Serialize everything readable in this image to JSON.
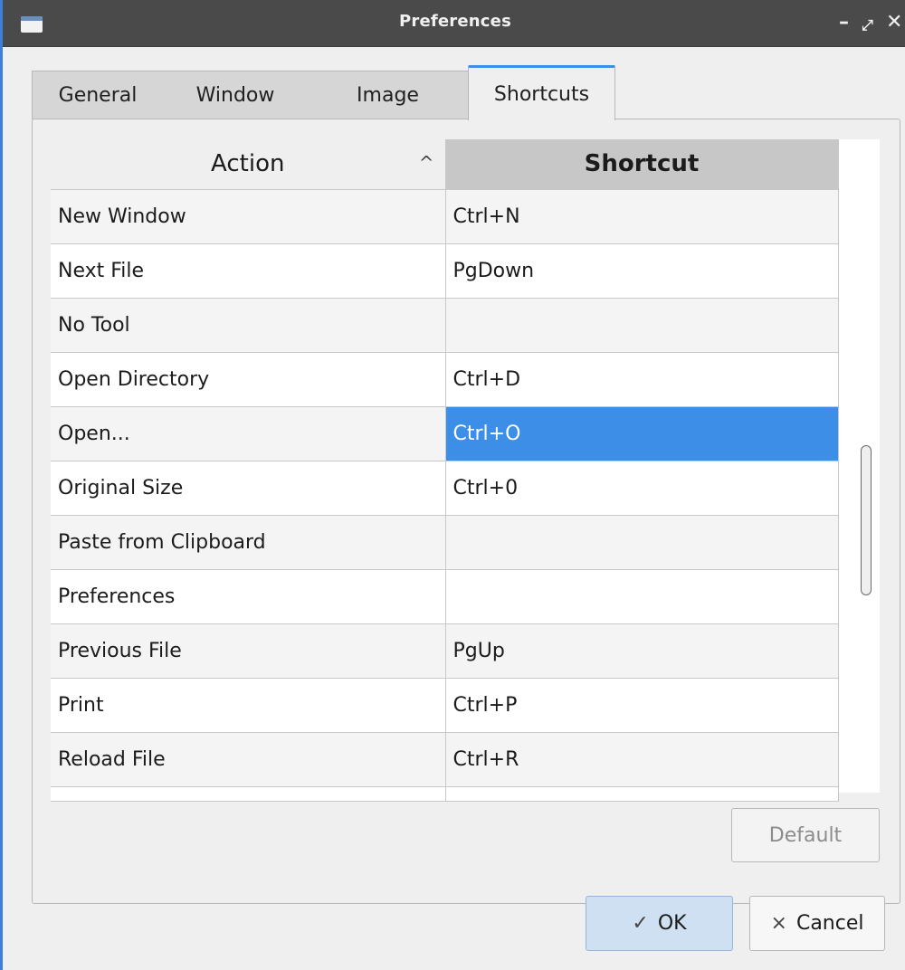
{
  "window": {
    "title": "Preferences",
    "controls": {
      "minimize": "–",
      "maximize": "⤢",
      "close": "✕"
    }
  },
  "tabs": [
    {
      "label": "General"
    },
    {
      "label": "Window"
    },
    {
      "label": "Image"
    },
    {
      "label": "Shortcuts",
      "active": true
    }
  ],
  "table": {
    "columns": {
      "action": "Action",
      "shortcut": "Shortcut"
    },
    "sort_indicator": "^",
    "rows": [
      {
        "action": "New Window",
        "shortcut": "Ctrl+N"
      },
      {
        "action": "Next File",
        "shortcut": "PgDown"
      },
      {
        "action": "No Tool",
        "shortcut": ""
      },
      {
        "action": "Open Directory",
        "shortcut": "Ctrl+D"
      },
      {
        "action": "Open...",
        "shortcut": "Ctrl+O",
        "selected": true
      },
      {
        "action": "Original Size",
        "shortcut": "Ctrl+0"
      },
      {
        "action": "Paste from Clipboard",
        "shortcut": ""
      },
      {
        "action": "Preferences",
        "shortcut": ""
      },
      {
        "action": "Previous File",
        "shortcut": "PgUp"
      },
      {
        "action": "Print",
        "shortcut": "Ctrl+P"
      },
      {
        "action": "Reload File",
        "shortcut": "Ctrl+R"
      }
    ]
  },
  "buttons": {
    "default": "Default",
    "ok": "OK",
    "ok_icon": "✓",
    "cancel": "Cancel",
    "cancel_icon": "×"
  },
  "colors": {
    "accent": "#3d8ee6",
    "titlebar": "#4a4a4a",
    "window_bg": "#efefef"
  }
}
